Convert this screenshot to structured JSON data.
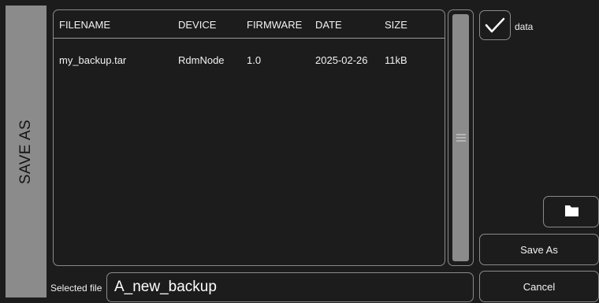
{
  "dialog": {
    "title": "SAVE AS"
  },
  "table": {
    "columns": [
      "FILENAME",
      "DEVICE",
      "FIRMWARE",
      "DATE",
      "SIZE"
    ],
    "rows": [
      {
        "filename": "my_backup.tar",
        "device": "RdmNode",
        "firmware": "1.0",
        "date": "2025-02-26",
        "size": "11kB"
      }
    ]
  },
  "options": {
    "data_checkbox": {
      "label": "data",
      "checked": true
    }
  },
  "icons": {
    "folder": "folder-icon",
    "check": "check-icon",
    "grip": "grip-lines-icon"
  },
  "buttons": {
    "save_label": "Save As",
    "cancel_label": "Cancel"
  },
  "selected_file": {
    "label": "Selected file",
    "value": "A_new_backup"
  },
  "colors": {
    "background": "#1c1c1c",
    "panel": "#8b8b8b",
    "border": "#8a8a8a",
    "text": "#ffffff"
  }
}
